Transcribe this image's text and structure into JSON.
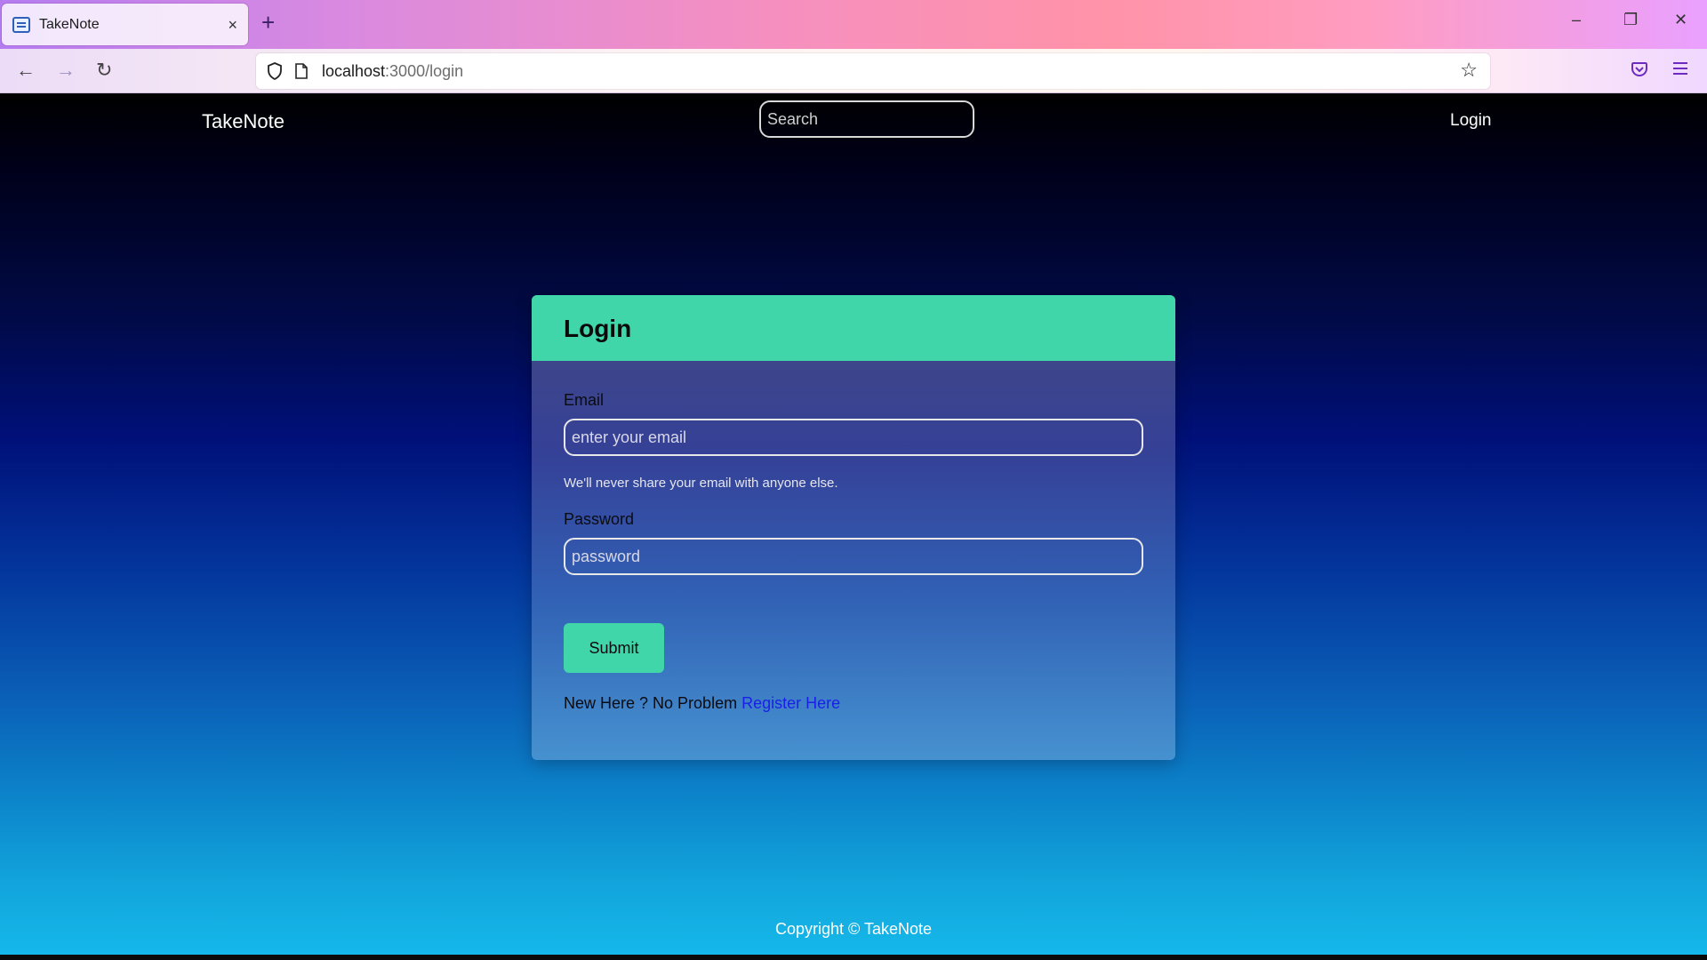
{
  "browser": {
    "tab_title": "TakeNote",
    "tab_close": "×",
    "new_tab": "+",
    "url_host": "localhost",
    "url_path": ":3000/login",
    "window_controls": {
      "minimize": "–",
      "restore": "❐",
      "close": "✕"
    },
    "nav": {
      "back": "←",
      "forward": "→",
      "reload": "↻"
    },
    "bookmark_star": "☆"
  },
  "site": {
    "brand": "TakeNote",
    "search_placeholder": "Search",
    "nav_login": "Login"
  },
  "login_card": {
    "title": "Login",
    "email_label": "Email",
    "email_placeholder": "enter your email",
    "email_help": "We'll never share your email with anyone else.",
    "password_label": "Password",
    "password_placeholder": "password",
    "submit_label": "Submit",
    "register_prompt": "New Here ? No Problem ",
    "register_link": "Register Here"
  },
  "footer": {
    "text": "Copyright © TakeNote"
  },
  "colors": {
    "accent_green": "#40d6a9",
    "link_blue": "#1a1fe8"
  }
}
